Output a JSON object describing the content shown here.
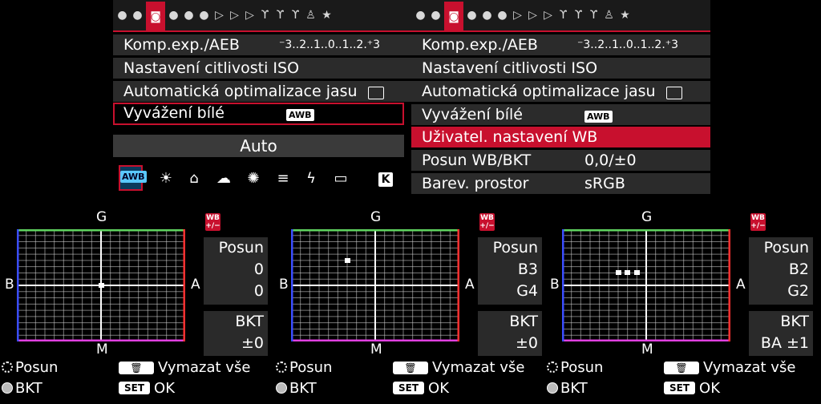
{
  "tab_icons": [
    "camera-1",
    "camera-2",
    "camera-3",
    "camera-4",
    "camera-5",
    "play-1",
    "play-2",
    "play-3",
    "tool-1",
    "tool-2",
    "tool-3",
    "custom",
    "mymenu"
  ],
  "left_menu": {
    "rows": [
      {
        "label": "Komp.exp./AEB",
        "value": "⁻3..2..1..0..1..2.⁺3"
      },
      {
        "label": "Nastavení citlivosti ISO",
        "value": ""
      },
      {
        "label": "Automatická optimalizace jasu",
        "value": ""
      },
      {
        "label": "Vyvážení bílé",
        "value": "AWB"
      }
    ],
    "auto_label": "Auto",
    "wb_icons": [
      "AWB",
      "☀",
      "⌂",
      "☁",
      "✺",
      "≡",
      "ϟ",
      "▭",
      "K"
    ],
    "selected_wb": "AWB"
  },
  "right_menu": {
    "rows": [
      {
        "label": "Komp.exp./AEB",
        "value": "⁻3..2..1..0..1..2.⁺3"
      },
      {
        "label": "Nastavení citlivosti ISO",
        "value": ""
      },
      {
        "label": "Automatická optimalizace jasu",
        "value": ""
      },
      {
        "label": "Vyvážení bílé",
        "value": "AWB"
      },
      {
        "label": "Uživatel. nastavení WB",
        "value": ""
      },
      {
        "label": "Posun WB/BKT",
        "value": "0,0/±0"
      },
      {
        "label": "Barev. prostor",
        "value": "sRGB"
      }
    ]
  },
  "wb_panels": [
    {
      "axis": {
        "g": "G",
        "m": "M",
        "b": "B",
        "a": "A"
      },
      "badge": "WB\n+/−",
      "posun_label": "Posun",
      "posun_v1": "0",
      "posun_v2": "0",
      "bkt_label": "BKT",
      "bkt_value": "±0",
      "footer": {
        "dial_label": "Posun",
        "trash_label": "Vymazat vše",
        "bkt_label": "BKT",
        "set_key": "SET",
        "set_label": "OK"
      }
    },
    {
      "axis": {
        "g": "G",
        "m": "M",
        "b": "B",
        "a": "A"
      },
      "badge": "WB\n+/−",
      "posun_label": "Posun",
      "posun_v1": "B3",
      "posun_v2": "G4",
      "bkt_label": "BKT",
      "bkt_value": "±0",
      "footer": {
        "dial_label": "Posun",
        "trash_label": "Vymazat vše",
        "bkt_label": "BKT",
        "set_key": "SET",
        "set_label": "OK"
      }
    },
    {
      "axis": {
        "g": "G",
        "m": "M",
        "b": "B",
        "a": "A"
      },
      "badge": "WB\n+/−",
      "posun_label": "Posun",
      "posun_v1": "B2",
      "posun_v2": "G2",
      "bkt_label": "BKT",
      "bkt_value": "BA ±1",
      "footer": {
        "dial_label": "Posun",
        "trash_label": "Vymazat vše",
        "bkt_label": "BKT",
        "set_key": "SET",
        "set_label": "OK"
      }
    }
  ],
  "colors": {
    "accent_red": "#c8102e",
    "grid_green": "#5fd35f",
    "grid_blue": "#3a4dff",
    "grid_red": "#ff3030",
    "grid_magenta": "#e040e0"
  }
}
